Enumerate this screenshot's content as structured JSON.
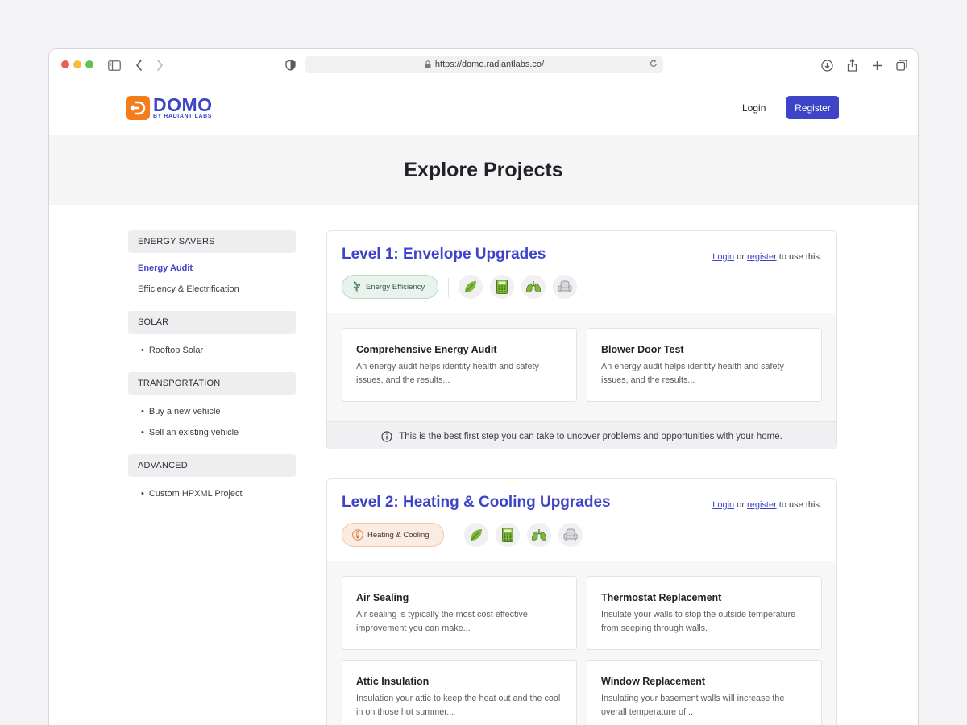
{
  "browser": {
    "url": "https://domo.radiantlabs.co/"
  },
  "header": {
    "logo_word": "DOMO",
    "logo_sub": "BY RADIANT LABS",
    "login_label": "Login",
    "register_label": "Register"
  },
  "hero": {
    "title": "Explore Projects"
  },
  "sidebar": {
    "groups": [
      {
        "label": "ENERGY SAVERS",
        "items": [
          "Energy Audit",
          "Efficiency & Electrification"
        ],
        "active": "Energy Audit"
      },
      {
        "label": "SOLAR",
        "items": [
          "Rooftop Solar"
        ]
      },
      {
        "label": "TRANSPORTATION",
        "items": [
          "Buy a new vehicle",
          "Sell an existing vehicle"
        ]
      },
      {
        "label": "ADVANCED",
        "items": [
          "Custom HPXML Project"
        ]
      }
    ]
  },
  "levels": [
    {
      "title": "Level 1: Envelope Upgrades",
      "cta_login": "Login",
      "cta_or": "or",
      "cta_register": "register",
      "cta_suffix": "to use this.",
      "tag_label": "Energy Efficiency",
      "tag_icon": "plant-icon",
      "benefit_icons": [
        "leaf-icon",
        "calculator-icon",
        "lungs-icon",
        "armchair-icon"
      ],
      "projects": [
        {
          "title": "Comprehensive Energy Audit",
          "desc": "An energy audit helps identity health and safety issues, and the results..."
        },
        {
          "title": "Blower Door Test",
          "desc": "An energy audit helps identity health and safety issues, and the results..."
        }
      ],
      "footer_note": "This is the best first step you can take to uncover problems and opportunities with your home."
    },
    {
      "title": "Level 2: Heating & Cooling Upgrades",
      "cta_login": "Login",
      "cta_or": "or",
      "cta_register": "register",
      "cta_suffix": "to use this.",
      "tag_label": "Heating & Cooling",
      "tag_icon": "thermometer-icon",
      "benefit_icons": [
        "leaf-icon",
        "calculator-icon",
        "lungs-icon",
        "armchair-icon"
      ],
      "projects": [
        {
          "title": "Air Sealing",
          "desc": "Air sealing is typically the most cost effective improvement you can make..."
        },
        {
          "title": "Thermostat Replacement",
          "desc": "Insulate your walls to stop the outside temperature from seeping through walls."
        },
        {
          "title": "Attic Insulation",
          "desc": "Insulation your attic to keep the heat out and the cool in on those hot summer..."
        },
        {
          "title": "Window Replacement",
          "desc": "Insulating your basement walls will increase the overall temperature of..."
        }
      ]
    }
  ],
  "colors": {
    "brand": "#3d44c8",
    "logo_orange": "#f47d1b",
    "leaf_green": "#7fb83a",
    "tag_green_bg": "#e9f3ee",
    "tag_orange_bg": "#fbece3"
  }
}
